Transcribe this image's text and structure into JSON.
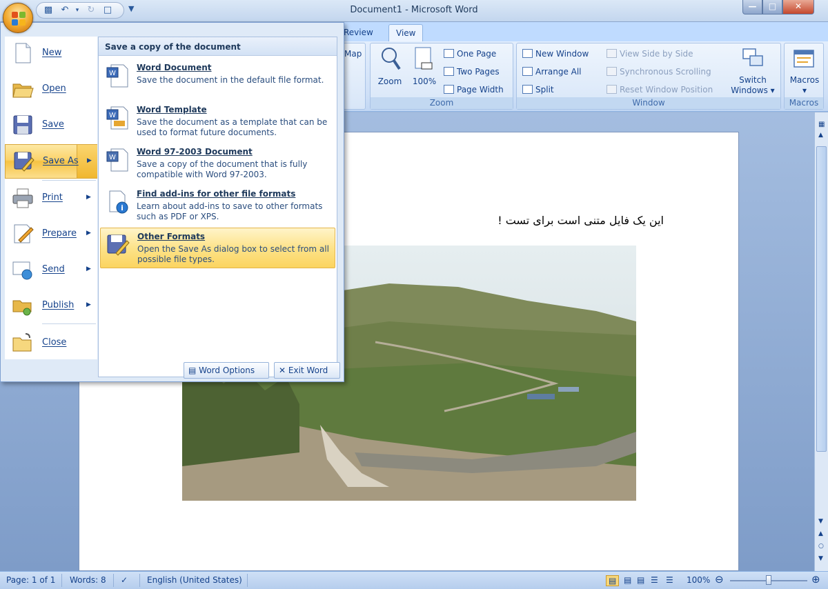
{
  "window": {
    "title": "Document1 - Microsoft Word"
  },
  "tabs": [
    {
      "label": "Review",
      "active": false
    },
    {
      "label": "View",
      "active": true
    }
  ],
  "ribbon": {
    "partial_label": "Map",
    "zoom_group": {
      "label": "Zoom",
      "zoom": "Zoom",
      "zoom100": "100%",
      "one_page": "One Page",
      "two_pages": "Two Pages",
      "page_width": "Page Width"
    },
    "window_group": {
      "label": "Window",
      "new_window": "New Window",
      "arrange_all": "Arrange All",
      "split": "Split",
      "view_side_by_side": "View Side by Side",
      "sync_scrolling": "Synchronous Scrolling",
      "reset_window": "Reset Window Position",
      "switch_windows_line1": "Switch",
      "switch_windows_line2": "Windows"
    },
    "macros_group": {
      "label": "Macros",
      "macros": "Macros"
    }
  },
  "office_menu": {
    "items": [
      {
        "label": "New",
        "icon": "new-document-icon",
        "has_submenu": false
      },
      {
        "label": "Open",
        "icon": "open-folder-icon",
        "has_submenu": false
      },
      {
        "label": "Save",
        "icon": "save-disk-icon",
        "has_submenu": false
      },
      {
        "label": "Save As",
        "icon": "save-as-icon",
        "has_submenu": true,
        "selected": true
      },
      {
        "label": "Print",
        "icon": "printer-icon",
        "has_submenu": true
      },
      {
        "label": "Prepare",
        "icon": "prepare-icon",
        "has_submenu": true
      },
      {
        "label": "Send",
        "icon": "send-icon",
        "has_submenu": true
      },
      {
        "label": "Publish",
        "icon": "publish-icon",
        "has_submenu": true
      },
      {
        "label": "Close",
        "icon": "close-folder-icon",
        "has_submenu": false
      }
    ],
    "submenu": {
      "header": "Save a copy of the document",
      "options": [
        {
          "title": "Word Document",
          "description": "Save the document in the default file format.",
          "icon": "word-document-icon"
        },
        {
          "title": "Word Template",
          "description": "Save the document as a template that can be used to format future documents.",
          "icon": "word-template-icon"
        },
        {
          "title": "Word 97-2003 Document",
          "description": "Save a copy of the document that is fully compatible with Word 97-2003.",
          "icon": "word-97-2003-icon"
        },
        {
          "title": "Find add-ins for other file formats",
          "description": "Learn about add-ins to save to other formats such as PDF or XPS.",
          "icon": "add-ins-icon"
        },
        {
          "title": "Other Formats",
          "description": "Open the Save As dialog box to select from all possible file types.",
          "icon": "other-formats-icon",
          "highlighted": true
        }
      ]
    },
    "word_options": "Word Options",
    "exit_word": "Exit Word"
  },
  "document": {
    "text": "این یک فایل متنی است برای تست !"
  },
  "status_bar": {
    "page": "Page: 1 of 1",
    "words": "Words: 8",
    "language": "English (United States)",
    "zoom": "100%"
  },
  "colors": {
    "accent": "#15428b",
    "ribbon": "#dbe7f7",
    "highlight": "#fbd460"
  }
}
